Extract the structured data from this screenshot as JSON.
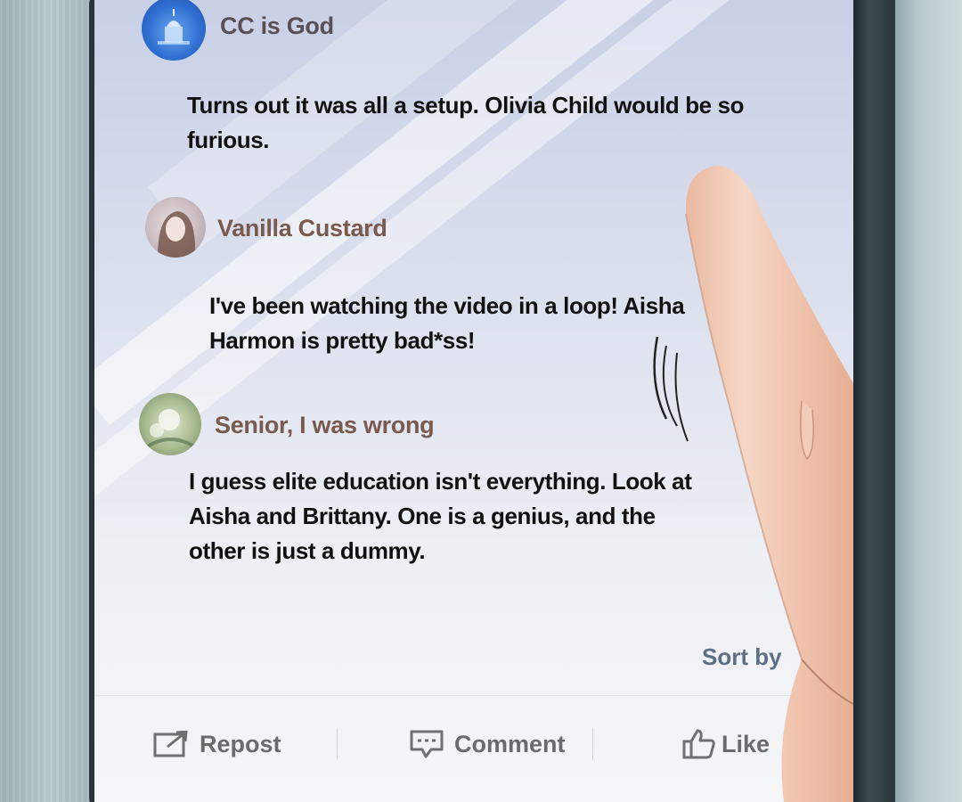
{
  "comments": [
    {
      "username": "CC is God",
      "text_lines": [
        "Turns out it was all a setup. Olivia Child would be so",
        "furious."
      ]
    },
    {
      "username": "Vanilla Custard",
      "text_lines": [
        "I've been watching the video in a loop! Aisha",
        "Harmon is pretty bad*ss!"
      ]
    },
    {
      "username": "Senior, I was wrong",
      "text_lines": [
        "I guess elite education isn't everything. Look at",
        "Aisha and Brittany. One is a genius, and the",
        "other is just a dummy."
      ]
    }
  ],
  "sort_label": "Sort by",
  "actions": {
    "repost": "Repost",
    "comment": "Comment",
    "like": "Like"
  },
  "icons": {
    "repost": "repost-icon",
    "comment": "comment-icon",
    "like": "thumbs-up-icon"
  }
}
